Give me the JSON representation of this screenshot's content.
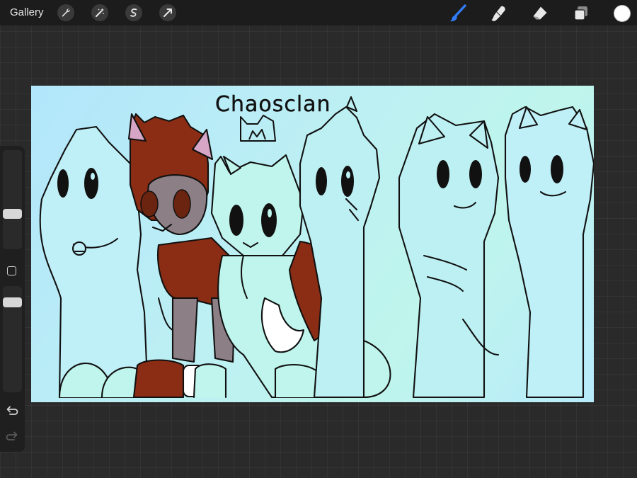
{
  "toolbar": {
    "gallery_label": "Gallery",
    "left_tools": [
      "wrench-icon",
      "magic-wand-icon",
      "selection-icon",
      "transform-arrow-icon"
    ],
    "right_tools": [
      "brush-icon",
      "smudge-icon",
      "eraser-icon",
      "layers-icon"
    ],
    "active_tool": "brush-icon",
    "active_color": "#ffffff",
    "accent_color": "#2f7cf6"
  },
  "sidebar": {
    "sliders": [
      "brush-size",
      "opacity"
    ],
    "buttons": [
      "modify-icon",
      "undo-icon",
      "redo-icon"
    ]
  },
  "artwork": {
    "title_text": "Chaosclan",
    "background_colors": [
      "#b2e6fb",
      "#bff5ec"
    ],
    "line_color": "#111111",
    "character_colors": {
      "fill": "#bff5ec",
      "brown": "#8a2d14",
      "dark_brown": "#6b2410",
      "grey": "#8d7f86",
      "ear_pink": "#d7a6c6"
    }
  }
}
